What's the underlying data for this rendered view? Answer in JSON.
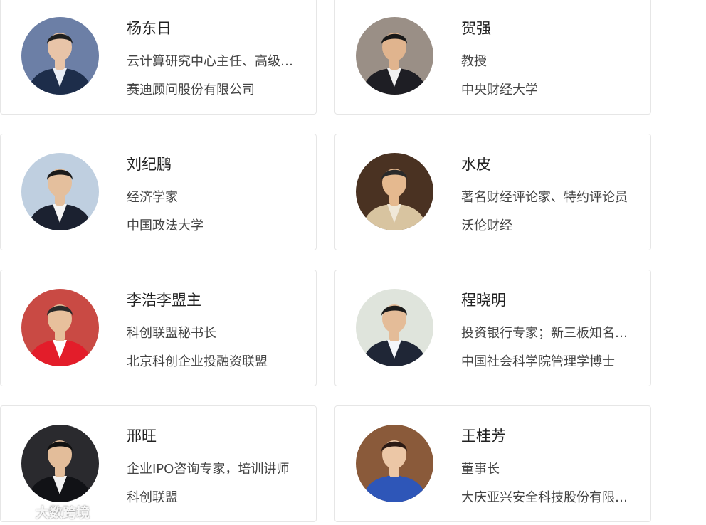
{
  "speakers": [
    {
      "name": "杨东日",
      "title": "云计算研究中心主任、高级分析师",
      "org": "赛迪顾问股份有限公司",
      "avatar_icon": "speaker-portrait-icon",
      "bg": "#6c7fa6",
      "suit": "#1d2d4a",
      "shirt": "#e9eef6",
      "face": "#e8c4a8",
      "hair": "#1f1f1f"
    },
    {
      "name": "贺强",
      "title": "教授",
      "org": "中央财经大学",
      "avatar_icon": "speaker-portrait-icon",
      "bg": "#9a8f86",
      "suit": "#1e1e24",
      "shirt": "#f1f1f1",
      "face": "#e0b48e",
      "hair": "#181818"
    },
    {
      "name": "刘纪鹏",
      "title": "经济学家",
      "org": "中国政法大学",
      "avatar_icon": "speaker-portrait-icon",
      "bg": "#bfcfe0",
      "suit": "#1b2130",
      "shirt": "#f5f5f5",
      "face": "#e4bf9d",
      "hair": "#1b1b1b"
    },
    {
      "name": "水皮",
      "title": "著名财经评论家、特约评论员",
      "org": "沃伦财经",
      "avatar_icon": "speaker-portrait-icon",
      "bg": "#4a3222",
      "suit": "#d8c4a0",
      "shirt": "#f0e8d8",
      "face": "#e5b98f",
      "hair": "#2a2a2a"
    },
    {
      "name": "李浩李盟主",
      "title": "科创联盟秘书长",
      "org": "北京科创企业投融资联盟",
      "avatar_icon": "speaker-portrait-icon",
      "bg": "#c94a44",
      "suit": "#e31d2a",
      "shirt": "#ffffff",
      "face": "#e7c09c",
      "hair": "#2a2a2a"
    },
    {
      "name": "程晓明",
      "title": "投资银行专家；新三板知名专家",
      "org": "中国社会科学院管理学博士",
      "avatar_icon": "speaker-portrait-icon",
      "bg": "#dfe4dc",
      "suit": "#1f2636",
      "shirt": "#f4f6fa",
      "face": "#e4bc98",
      "hair": "#1c1c1c"
    },
    {
      "name": "邢旺",
      "title": "企业IPO咨询专家，培训讲师",
      "org": "科创联盟",
      "avatar_icon": "speaker-portrait-icon",
      "bg": "#2a2a2e",
      "suit": "#111216",
      "shirt": "#f2f2f2",
      "face": "#e3bd9a",
      "hair": "#111111"
    },
    {
      "name": "王桂芳",
      "title": "董事长",
      "org": "大庆亚兴安全科技股份有限公司",
      "avatar_icon": "speaker-portrait-icon",
      "bg": "#8a5a3a",
      "suit": "#2e56b8",
      "shirt": "#2e56b8",
      "face": "#ecc7a6",
      "hair": "#2b1a14"
    }
  ],
  "watermark": {
    "text": "大数跨境",
    "icon": "brand-logo-icon"
  }
}
